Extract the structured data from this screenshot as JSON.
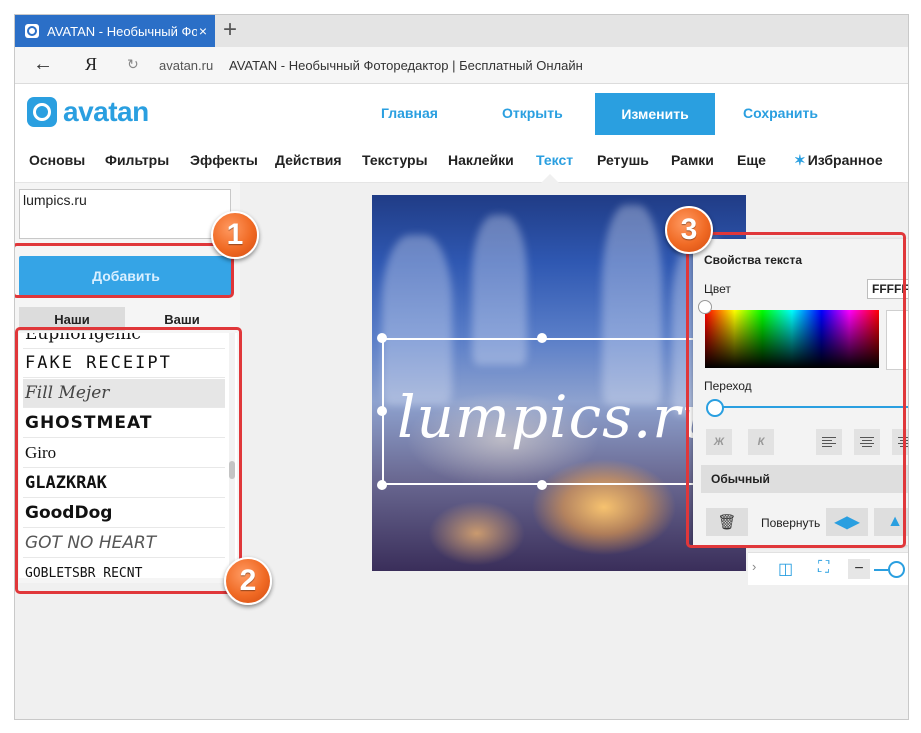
{
  "browser": {
    "tab_title": "AVATAN - Необычный Фо",
    "tab_close": "×",
    "new_tab": "+",
    "yandex": "Я",
    "url": "avatan.ru",
    "page_title": "AVATAN - Необычный Фотоpедактор | Бесплатный Онлайн"
  },
  "header": {
    "logo_text": "avatan",
    "nav": [
      "Главная",
      "Открыть",
      "Изменить",
      "Сохранить"
    ]
  },
  "categories": [
    "Основы",
    "Фильтры",
    "Эффекты",
    "Действия",
    "Текстуры",
    "Наклейки",
    "Текст",
    "Ретушь",
    "Рамки",
    "Еще",
    "Избранное"
  ],
  "active_category": "Текст",
  "text_panel": {
    "input_value": "lumpics.ru",
    "add_button": "Добавить",
    "tabs": [
      "Наши",
      "Ваши"
    ],
    "fonts": [
      "Euphorigenic",
      "FAKE RECEIPT",
      "Fill Mejer",
      "GHOSTMEAT",
      "Giro",
      "GLAZKRAK",
      "GoodDog",
      "GOT NO HEART",
      "GOBLETSBR RECNT"
    ]
  },
  "canvas": {
    "text": "lumpics.ru"
  },
  "properties": {
    "title": "Свойства текста",
    "color_label": "Цвет",
    "color_value": "FFFFFF",
    "transition_label": "Переход",
    "bold": "Ж",
    "italic": "К",
    "style": "Обычный",
    "rotate_label": "Повернуть"
  },
  "annotations": [
    "1",
    "2",
    "3"
  ],
  "colors": {
    "accent": "#2a9fe0",
    "annotation": "#e0373a",
    "badge": "#f06a24"
  }
}
